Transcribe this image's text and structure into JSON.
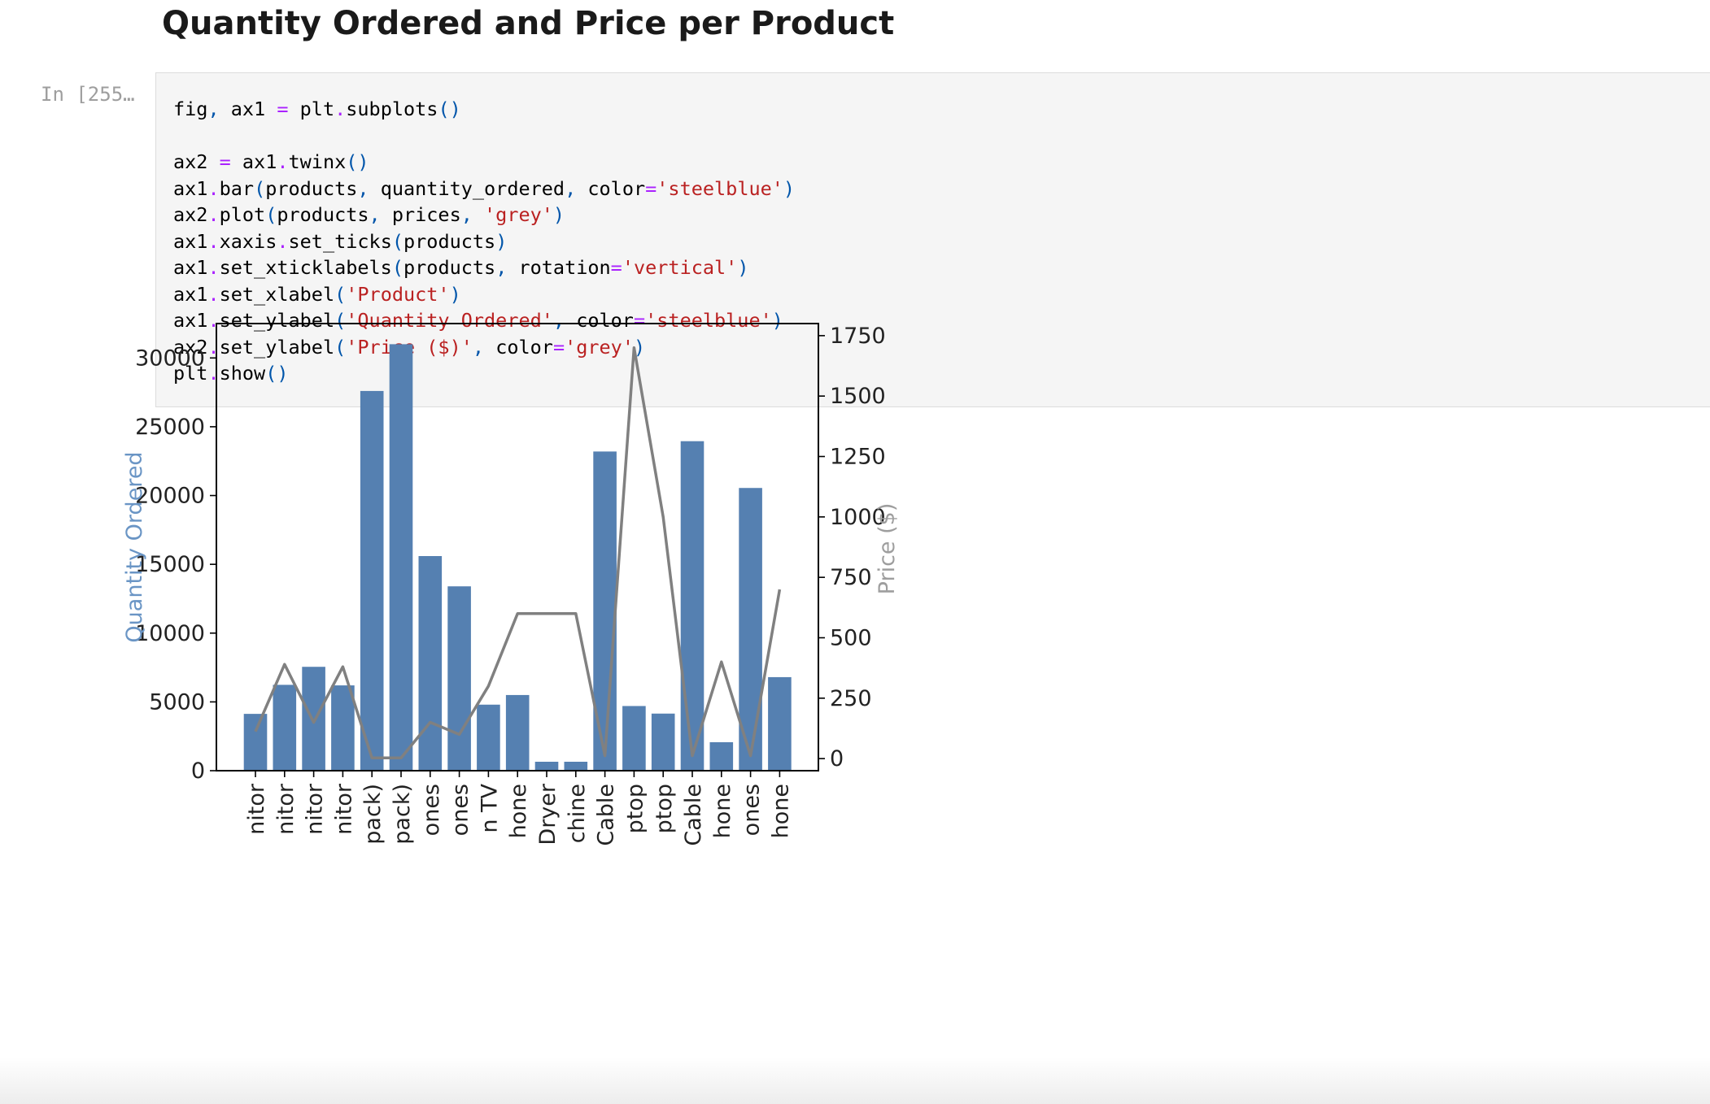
{
  "page": {
    "heading": "Quantity Ordered and Price per Product"
  },
  "cell": {
    "prompt": "In [255…",
    "code": [
      [
        [
          "fig",
          "n"
        ],
        [
          ", ",
          "p"
        ],
        [
          "ax1 ",
          "n"
        ],
        [
          "=",
          "o"
        ],
        [
          " plt",
          "n"
        ],
        [
          ".",
          "o"
        ],
        [
          "subplots",
          "n"
        ],
        [
          "()",
          "p"
        ]
      ],
      [],
      [
        [
          "ax2 ",
          "n"
        ],
        [
          "=",
          "o"
        ],
        [
          " ax1",
          "n"
        ],
        [
          ".",
          "o"
        ],
        [
          "twinx",
          "n"
        ],
        [
          "()",
          "p"
        ]
      ],
      [
        [
          "ax1",
          "n"
        ],
        [
          ".",
          "o"
        ],
        [
          "bar",
          "n"
        ],
        [
          "(",
          "p"
        ],
        [
          "products",
          "n"
        ],
        [
          ", ",
          "p"
        ],
        [
          "quantity_ordered",
          "n"
        ],
        [
          ", ",
          "p"
        ],
        [
          "color",
          "n"
        ],
        [
          "=",
          "o"
        ],
        [
          "'steelblue'",
          "s"
        ],
        [
          ")",
          "p"
        ]
      ],
      [
        [
          "ax2",
          "n"
        ],
        [
          ".",
          "o"
        ],
        [
          "plot",
          "n"
        ],
        [
          "(",
          "p"
        ],
        [
          "products",
          "n"
        ],
        [
          ", ",
          "p"
        ],
        [
          "prices",
          "n"
        ],
        [
          ", ",
          "p"
        ],
        [
          "'grey'",
          "s"
        ],
        [
          ")",
          "p"
        ]
      ],
      [
        [
          "ax1",
          "n"
        ],
        [
          ".",
          "o"
        ],
        [
          "xaxis",
          "n"
        ],
        [
          ".",
          "o"
        ],
        [
          "set_ticks",
          "n"
        ],
        [
          "(",
          "p"
        ],
        [
          "products",
          "n"
        ],
        [
          ")",
          "p"
        ]
      ],
      [
        [
          "ax1",
          "n"
        ],
        [
          ".",
          "o"
        ],
        [
          "set_xticklabels",
          "n"
        ],
        [
          "(",
          "p"
        ],
        [
          "products",
          "n"
        ],
        [
          ", ",
          "p"
        ],
        [
          "rotation",
          "n"
        ],
        [
          "=",
          "o"
        ],
        [
          "'vertical'",
          "s"
        ],
        [
          ")",
          "p"
        ]
      ],
      [
        [
          "ax1",
          "n"
        ],
        [
          ".",
          "o"
        ],
        [
          "set_xlabel",
          "n"
        ],
        [
          "(",
          "p"
        ],
        [
          "'Product'",
          "s"
        ],
        [
          ")",
          "p"
        ]
      ],
      [
        [
          "ax1",
          "n"
        ],
        [
          ".",
          "o"
        ],
        [
          "set_ylabel",
          "n"
        ],
        [
          "(",
          "p"
        ],
        [
          "'Quantity Ordered'",
          "s"
        ],
        [
          ", ",
          "p"
        ],
        [
          "color",
          "n"
        ],
        [
          "=",
          "o"
        ],
        [
          "'steelblue'",
          "s"
        ],
        [
          ")",
          "p"
        ]
      ],
      [
        [
          "ax2",
          "n"
        ],
        [
          ".",
          "o"
        ],
        [
          "set_ylabel",
          "n"
        ],
        [
          "(",
          "p"
        ],
        [
          "'Price ($)'",
          "s"
        ],
        [
          ", ",
          "p"
        ],
        [
          "color",
          "n"
        ],
        [
          "=",
          "o"
        ],
        [
          "'grey'",
          "s"
        ],
        [
          ")",
          "p"
        ]
      ],
      [
        [
          "plt",
          "n"
        ],
        [
          ".",
          "o"
        ],
        [
          "show",
          "n"
        ],
        [
          "()",
          "p"
        ]
      ]
    ]
  },
  "chart_data": {
    "type": "bar",
    "title": "",
    "xlabel": "",
    "ylabel": "Quantity Ordered",
    "y2label": "Price ($)",
    "ylim": [
      0,
      32500
    ],
    "y2lim": [
      -50,
      1800
    ],
    "yticks": [
      0,
      5000,
      10000,
      15000,
      20000,
      25000,
      30000
    ],
    "y2ticks": [
      0,
      250,
      500,
      750,
      1000,
      1250,
      1500,
      1750
    ],
    "categories": [
      "nitor",
      "nitor",
      "nitor",
      "nitor",
      "pack)",
      "pack)",
      "ones",
      "ones",
      "n TV",
      "hone",
      "Dryer",
      "chine",
      "Cable",
      "ptop",
      "ptop",
      "Cable",
      "hone",
      "ones",
      "hone"
    ],
    "series": [
      {
        "kind": "bar",
        "axis": "left",
        "color": "#5580b1",
        "values": [
          4130,
          6240,
          7550,
          6200,
          27600,
          31000,
          15600,
          13400,
          4800,
          5500,
          650,
          650,
          23200,
          4700,
          4150,
          23950,
          2070,
          20550,
          6800
        ]
      },
      {
        "kind": "line",
        "axis": "right",
        "color": "#808080",
        "values": [
          112,
          390,
          150,
          380,
          3,
          3,
          150,
          100,
          300,
          600,
          600,
          600,
          12,
          1700,
          1000,
          12,
          400,
          12,
          700
        ]
      }
    ],
    "grid": false,
    "legend": "none"
  }
}
